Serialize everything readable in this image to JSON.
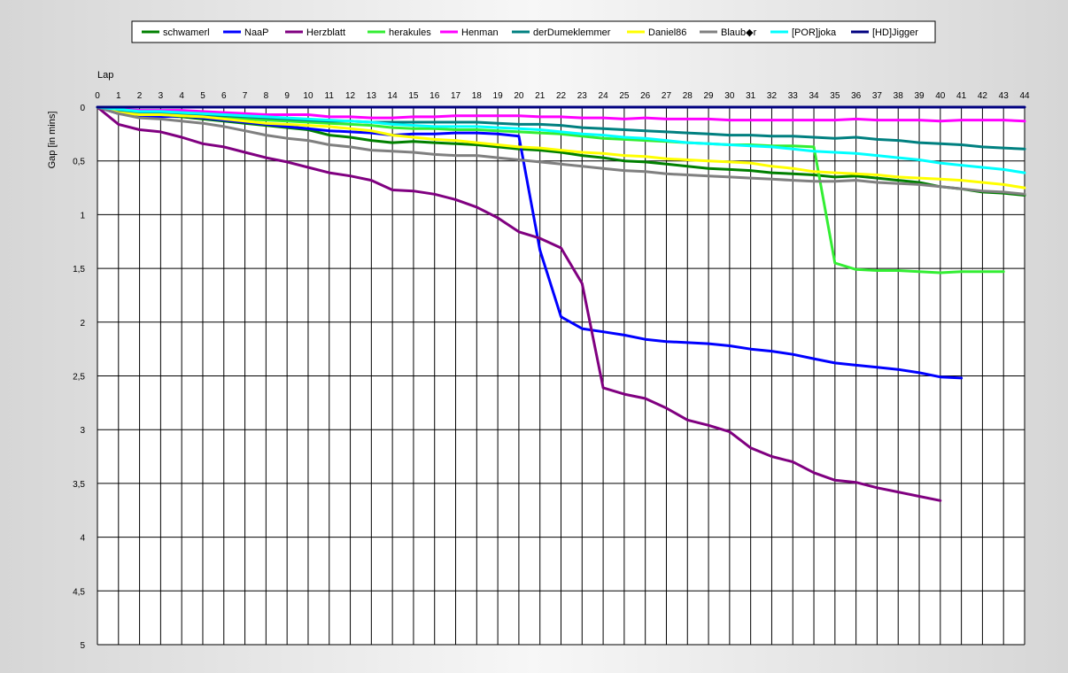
{
  "chart_data": {
    "type": "line",
    "title": "",
    "xlabel": "Lap",
    "ylabel": "Gap [in mins]",
    "xlim": [
      0,
      44
    ],
    "ylim": [
      0,
      5
    ],
    "y_inverted": true,
    "grid": true,
    "legend_position": "top",
    "x_ticks": [
      "0",
      "1",
      "2",
      "3",
      "4",
      "5",
      "6",
      "7",
      "8",
      "9",
      "10",
      "11",
      "12",
      "13",
      "14",
      "15",
      "16",
      "17",
      "18",
      "19",
      "20",
      "21",
      "22",
      "23",
      "24",
      "25",
      "26",
      "27",
      "28",
      "29",
      "30",
      "31",
      "32",
      "33",
      "34",
      "35",
      "36",
      "37",
      "38",
      "39",
      "40",
      "41",
      "42",
      "43",
      "44"
    ],
    "y_ticks": [
      {
        "value": 0,
        "label": "0"
      },
      {
        "value": 0.5,
        "label": "0,5"
      },
      {
        "value": 1,
        "label": "1"
      },
      {
        "value": 1.5,
        "label": "1,5"
      },
      {
        "value": 2,
        "label": "2"
      },
      {
        "value": 2.5,
        "label": "2,5"
      },
      {
        "value": 3,
        "label": "3"
      },
      {
        "value": 3.5,
        "label": "3,5"
      },
      {
        "value": 4,
        "label": "4"
      },
      {
        "value": 4.5,
        "label": "4,5"
      },
      {
        "value": 5,
        "label": "5"
      }
    ],
    "series": [
      {
        "name": "schwamerl",
        "color": "#008000",
        "start": 0,
        "values": [
          0,
          0.06,
          0.08,
          0.08,
          0.09,
          0.11,
          0.13,
          0.15,
          0.17,
          0.19,
          0.21,
          0.26,
          0.28,
          0.31,
          0.33,
          0.32,
          0.33,
          0.34,
          0.35,
          0.37,
          0.39,
          0.4,
          0.42,
          0.45,
          0.47,
          0.5,
          0.51,
          0.53,
          0.55,
          0.57,
          0.58,
          0.59,
          0.61,
          0.62,
          0.63,
          0.65,
          0.64,
          0.66,
          0.68,
          0.7,
          0.74,
          0.76,
          0.79,
          0.8,
          0.82
        ]
      },
      {
        "name": "NaaP",
        "color": "#0000ff",
        "start": 0,
        "values": [
          0,
          0.06,
          0.09,
          0.09,
          0.08,
          0.1,
          0.12,
          0.14,
          0.16,
          0.18,
          0.2,
          0.22,
          0.23,
          0.24,
          0.26,
          0.25,
          0.25,
          0.24,
          0.24,
          0.25,
          0.27,
          1.33,
          1.95,
          2.06,
          2.09,
          2.12,
          2.16,
          2.18,
          2.19,
          2.2,
          2.22,
          2.25,
          2.27,
          2.3,
          2.34,
          2.38,
          2.4,
          2.42,
          2.44,
          2.47,
          2.51,
          2.52
        ]
      },
      {
        "name": "Herzblatt",
        "color": "#800080",
        "start": 0,
        "values": [
          0,
          0.16,
          0.21,
          0.23,
          0.28,
          0.34,
          0.37,
          0.42,
          0.47,
          0.51,
          0.56,
          0.61,
          0.64,
          0.68,
          0.77,
          0.78,
          0.81,
          0.86,
          0.93,
          1.03,
          1.16,
          1.22,
          1.31,
          1.64,
          2.61,
          2.67,
          2.71,
          2.8,
          2.91,
          2.96,
          3.02,
          3.17,
          3.25,
          3.3,
          3.4,
          3.47,
          3.49,
          3.54,
          3.58,
          3.62,
          3.66
        ]
      },
      {
        "name": "herakules",
        "color": "#33ee33",
        "start": 0,
        "values": [
          0,
          0.04,
          0.06,
          0.07,
          0.08,
          0.09,
          0.1,
          0.11,
          0.12,
          0.13,
          0.14,
          0.15,
          0.16,
          0.17,
          0.19,
          0.2,
          0.2,
          0.21,
          0.21,
          0.22,
          0.23,
          0.24,
          0.25,
          0.27,
          0.29,
          0.3,
          0.31,
          0.32,
          0.33,
          0.34,
          0.35,
          0.35,
          0.36,
          0.36,
          0.37,
          1.45,
          1.51,
          1.52,
          1.52,
          1.53,
          1.54,
          1.53,
          1.53,
          1.53
        ]
      },
      {
        "name": "Henman",
        "color": "#ff00ff",
        "start": 0,
        "values": [
          0,
          0.02,
          0.03,
          0.03,
          0.03,
          0.04,
          0.05,
          0.06,
          0.07,
          0.07,
          0.07,
          0.09,
          0.09,
          0.1,
          0.1,
          0.09,
          0.09,
          0.08,
          0.08,
          0.08,
          0.08,
          0.09,
          0.09,
          0.1,
          0.1,
          0.11,
          0.1,
          0.11,
          0.11,
          0.11,
          0.12,
          0.12,
          0.12,
          0.12,
          0.12,
          0.12,
          0.11,
          0.12,
          0.12,
          0.12,
          0.13,
          0.12,
          0.12,
          0.12,
          0.13
        ]
      },
      {
        "name": "derDumeklemmer",
        "color": "#008080",
        "start": 0,
        "values": [
          0,
          0.03,
          0.05,
          0.06,
          0.07,
          0.07,
          0.08,
          0.09,
          0.1,
          0.11,
          0.12,
          0.13,
          0.13,
          0.14,
          0.14,
          0.14,
          0.14,
          0.14,
          0.14,
          0.15,
          0.16,
          0.16,
          0.17,
          0.19,
          0.2,
          0.21,
          0.22,
          0.23,
          0.24,
          0.25,
          0.26,
          0.26,
          0.27,
          0.27,
          0.28,
          0.29,
          0.28,
          0.3,
          0.31,
          0.33,
          0.34,
          0.35,
          0.37,
          0.38,
          0.39
        ]
      },
      {
        "name": "Daniel86",
        "color": "#ffff00",
        "start": 0,
        "values": [
          0,
          0.05,
          0.07,
          0.07,
          0.08,
          0.09,
          0.11,
          0.13,
          0.15,
          0.16,
          0.17,
          0.18,
          0.2,
          0.22,
          0.26,
          0.28,
          0.3,
          0.31,
          0.33,
          0.35,
          0.37,
          0.38,
          0.4,
          0.42,
          0.43,
          0.45,
          0.46,
          0.48,
          0.49,
          0.5,
          0.51,
          0.52,
          0.55,
          0.57,
          0.6,
          0.61,
          0.62,
          0.63,
          0.65,
          0.66,
          0.67,
          0.68,
          0.7,
          0.72,
          0.75
        ]
      },
      {
        "name": "Blaubür",
        "legend_label": "Blaub◆r",
        "color": "#808080",
        "start": 0,
        "values": [
          0,
          0.06,
          0.1,
          0.11,
          0.13,
          0.15,
          0.18,
          0.22,
          0.26,
          0.29,
          0.31,
          0.35,
          0.37,
          0.4,
          0.41,
          0.42,
          0.44,
          0.45,
          0.45,
          0.47,
          0.49,
          0.51,
          0.53,
          0.55,
          0.57,
          0.59,
          0.6,
          0.62,
          0.63,
          0.64,
          0.65,
          0.66,
          0.67,
          0.68,
          0.69,
          0.69,
          0.68,
          0.7,
          0.71,
          0.72,
          0.74,
          0.76,
          0.78,
          0.79,
          0.81
        ]
      },
      {
        "name": "[POR]joka",
        "color": "#00ffff",
        "start": 0,
        "values": [
          0,
          0.02,
          0.04,
          0.04,
          0.05,
          0.06,
          0.07,
          0.08,
          0.09,
          0.1,
          0.11,
          0.12,
          0.13,
          0.14,
          0.16,
          0.17,
          0.18,
          0.18,
          0.18,
          0.19,
          0.2,
          0.21,
          0.23,
          0.25,
          0.26,
          0.28,
          0.29,
          0.31,
          0.33,
          0.34,
          0.35,
          0.36,
          0.37,
          0.39,
          0.41,
          0.42,
          0.43,
          0.45,
          0.47,
          0.49,
          0.52,
          0.54,
          0.56,
          0.58,
          0.61
        ]
      },
      {
        "name": "[HD]Jigger",
        "color": "#000080",
        "start": 0,
        "values": [
          0,
          0,
          0,
          0,
          0,
          0,
          0,
          0,
          0,
          0,
          0,
          0,
          0,
          0,
          0,
          0,
          0,
          0,
          0,
          0,
          0,
          0,
          0,
          0,
          0,
          0,
          0,
          0,
          0,
          0,
          0,
          0,
          0,
          0,
          0,
          0,
          0,
          0,
          0,
          0,
          0,
          0,
          0,
          0,
          0
        ]
      }
    ]
  }
}
